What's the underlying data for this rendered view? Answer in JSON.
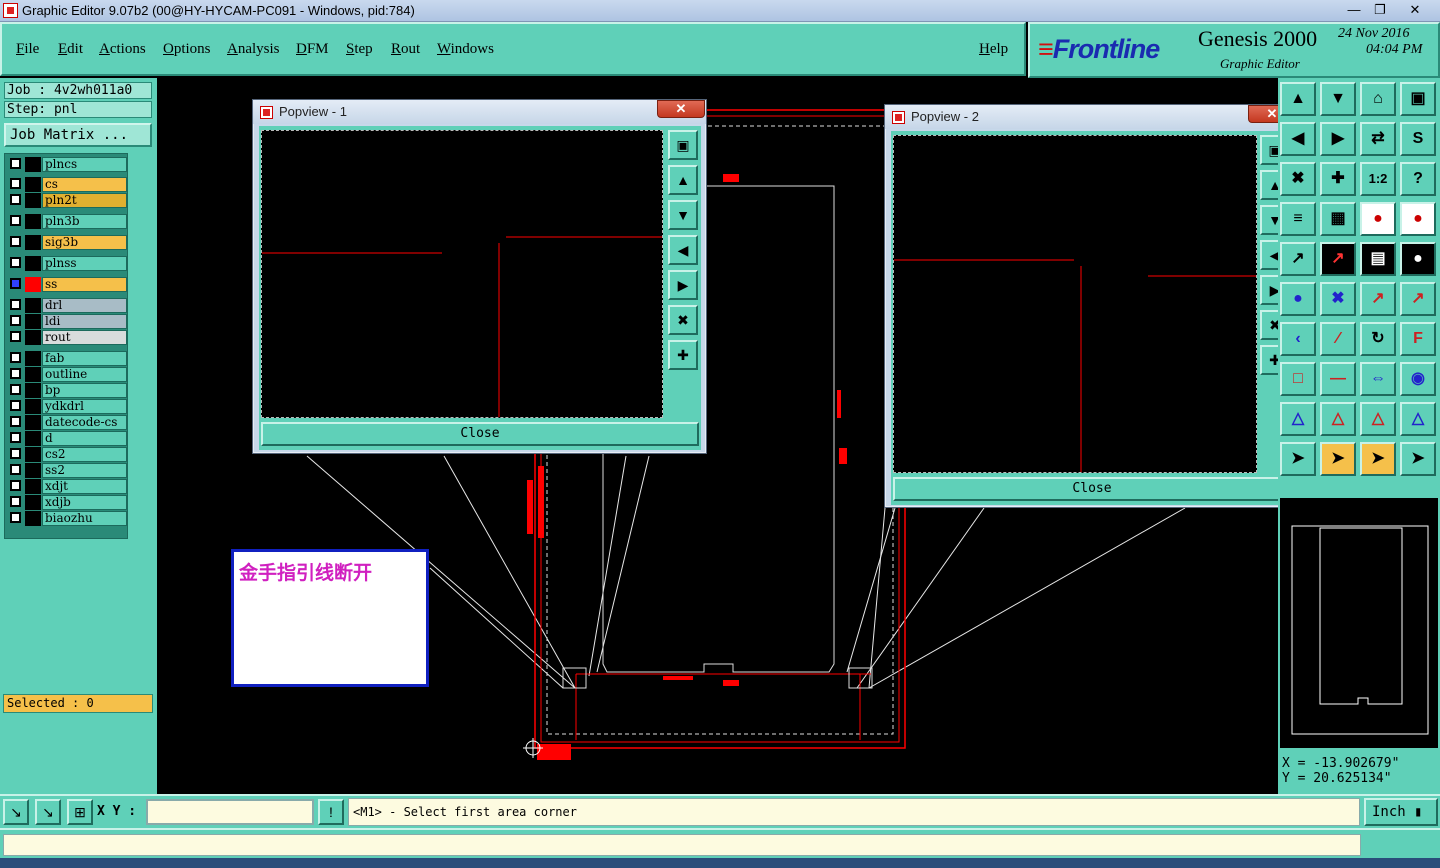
{
  "window": {
    "title": "Graphic Editor 9.07b2 (00@HY-HYCAM-PC091 - Windows, pid:784)",
    "minimize": "—",
    "restore": "❐",
    "close": "✕"
  },
  "menu": {
    "items": [
      "File",
      "Edit",
      "Actions",
      "Options",
      "Analysis",
      "DFM",
      "Step",
      "Rout",
      "Windows"
    ],
    "help": "Help"
  },
  "brand": {
    "logo": "Frontline",
    "product": "Genesis 2000",
    "subtitle": "Graphic Editor",
    "date": "24 Nov 2016",
    "time": "04:04 PM"
  },
  "job": {
    "job_line": "Job : 4v2wh011a0",
    "step_line": "Step: pnl",
    "matrix_button": "Job Matrix ..."
  },
  "layers": [
    {
      "name": "plncs",
      "color": "#000000",
      "bg": "teal",
      "active": false
    },
    {
      "name": "cs",
      "color": "#000000",
      "bg": "yellow",
      "active": false
    },
    {
      "name": "pln2t",
      "color": "#000000",
      "bg": "gold",
      "active": false
    },
    {
      "name": "pln3b",
      "color": "#000000",
      "bg": "teal",
      "active": false
    },
    {
      "name": "sig3b",
      "color": "#000000",
      "bg": "yellow",
      "active": false
    },
    {
      "name": "plnss",
      "color": "#000000",
      "bg": "teal",
      "active": false
    },
    {
      "name": "ss",
      "color": "#ff0000",
      "bg": "yellow",
      "active": true
    },
    {
      "name": "drl",
      "color": "#000000",
      "bg": "grey",
      "active": false
    },
    {
      "name": "ldi",
      "color": "#000000",
      "bg": "grey",
      "active": false
    },
    {
      "name": "rout",
      "color": "#000000",
      "bg": "light",
      "active": false
    },
    {
      "name": "fab",
      "color": "#000000",
      "bg": "teal",
      "active": false
    },
    {
      "name": "outline",
      "color": "#000000",
      "bg": "teal",
      "active": false
    },
    {
      "name": "bp",
      "color": "#000000",
      "bg": "teal",
      "active": false
    },
    {
      "name": "ydkdrl",
      "color": "#000000",
      "bg": "teal",
      "active": false
    },
    {
      "name": "datecode-cs",
      "color": "#000000",
      "bg": "teal",
      "active": false
    },
    {
      "name": "d",
      "color": "#000000",
      "bg": "teal",
      "active": false
    },
    {
      "name": "cs2",
      "color": "#000000",
      "bg": "teal",
      "active": false
    },
    {
      "name": "ss2",
      "color": "#000000",
      "bg": "teal",
      "active": false
    },
    {
      "name": "xdjt",
      "color": "#000000",
      "bg": "teal",
      "active": false
    },
    {
      "name": "xdjb",
      "color": "#000000",
      "bg": "teal",
      "active": false
    },
    {
      "name": "biaozhu",
      "color": "#000000",
      "bg": "teal",
      "active": false
    }
  ],
  "selected": "Selected : 0",
  "popview1": {
    "title": "Popview - 1",
    "close_label": "Close",
    "close_x": "✕"
  },
  "popview2": {
    "title": "Popview - 2",
    "close_label": "Close",
    "close_x": "✕"
  },
  "annotation": "金手指引线断开",
  "coords": {
    "x": "X = -13.902679\"",
    "y": "Y = 20.625134\""
  },
  "command": {
    "xy_label": "X Y :",
    "xy_value": "",
    "prompt": "<M1> - Select first area corner",
    "units": "Inch"
  },
  "colors": {
    "accent": "#5fd0b8",
    "layer_red": "#ff0000",
    "annotation_text": "#d020c0",
    "annotation_border": "#1020c0"
  }
}
